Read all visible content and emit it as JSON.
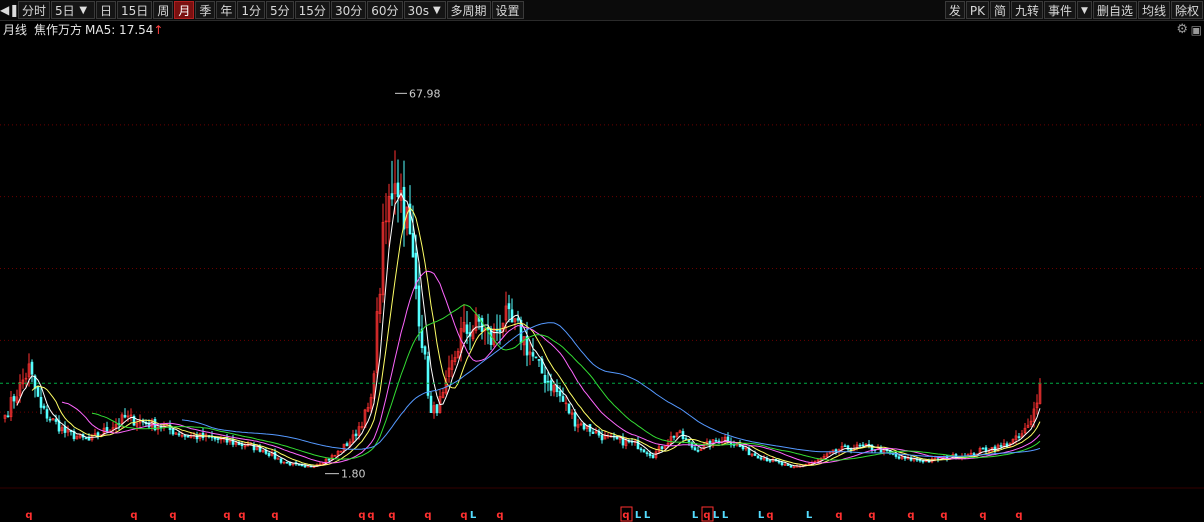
{
  "toolbar": {
    "left": [
      {
        "label": "分时",
        "active": false
      },
      {
        "label": "5日",
        "active": false,
        "dropdown": true
      },
      {
        "label": "日",
        "active": false
      },
      {
        "label": "15日",
        "active": false
      },
      {
        "label": "周",
        "active": false
      },
      {
        "label": "月",
        "active": true
      },
      {
        "label": "季",
        "active": false
      },
      {
        "label": "年",
        "active": false
      },
      {
        "label": "1分",
        "active": false
      },
      {
        "label": "5分",
        "active": false
      },
      {
        "label": "15分",
        "active": false
      },
      {
        "label": "30分",
        "active": false
      },
      {
        "label": "60分",
        "active": false
      },
      {
        "label": "30s",
        "active": false,
        "dropdown": true
      },
      {
        "label": "多周期",
        "active": false
      },
      {
        "label": "设置",
        "active": false
      }
    ],
    "right": [
      {
        "label": "发"
      },
      {
        "label": "PK"
      },
      {
        "label": "简"
      },
      {
        "label": "九转"
      },
      {
        "label": "事件",
        "dropdown": true
      },
      {
        "label": "删自选"
      },
      {
        "label": "均线"
      },
      {
        "label": "除权"
      }
    ],
    "icons": {
      "toggle": "sidebar-toggle-icon",
      "dropdown": "triangle-down-icon",
      "gear": "gear-icon",
      "expand": "expand-icon"
    }
  },
  "info": {
    "period": "月线",
    "name": "焦作万方",
    "ma_label": "MA5: 17.54",
    "ma_arrow": "↑"
  },
  "colors": {
    "background": "#000000",
    "up": "#ff3232",
    "down": "#54ffff",
    "ma5": "#ffffff",
    "ma10": "#ffff66",
    "ma20": "#ff66ff",
    "ma30": "#33dd33",
    "ma60": "#5599ff",
    "grid": "#6a0000",
    "current_line": "#00aa44",
    "q": "#ff3030",
    "L": "#55ddff"
  },
  "chart_data": {
    "type": "candlestick",
    "period": "monthly",
    "symbol_name": "焦作万方",
    "ylim": [
      0,
      75
    ],
    "price_high_label": "67.98",
    "price_low_label": "1.80",
    "current_price": 17.54,
    "ma": [
      {
        "name": "MA5",
        "color": "#ffffff"
      },
      {
        "name": "MA10",
        "color": "#ffff66"
      },
      {
        "name": "MA20",
        "color": "#ff66ff"
      },
      {
        "name": "MA30",
        "color": "#33dd33"
      },
      {
        "name": "MA60",
        "color": "#5599ff"
      }
    ],
    "close_anchors": [
      [
        0,
        12.0
      ],
      [
        8,
        20.0
      ],
      [
        12,
        13.0
      ],
      [
        20,
        9.0
      ],
      [
        28,
        7.5
      ],
      [
        40,
        11.5
      ],
      [
        52,
        10.0
      ],
      [
        60,
        8.5
      ],
      [
        68,
        8.0
      ],
      [
        78,
        7.0
      ],
      [
        86,
        6.0
      ],
      [
        92,
        4.0
      ],
      [
        100,
        2.8
      ],
      [
        104,
        3.5
      ],
      [
        110,
        5.0
      ],
      [
        116,
        8.0
      ],
      [
        122,
        14.0
      ],
      [
        126,
        42.0
      ],
      [
        130,
        55.0
      ],
      [
        134,
        46.0
      ],
      [
        138,
        30.0
      ],
      [
        142,
        12.0
      ],
      [
        146,
        15.0
      ],
      [
        152,
        26.0
      ],
      [
        158,
        28.0
      ],
      [
        162,
        25.0
      ],
      [
        166,
        29.0
      ],
      [
        172,
        26.0
      ],
      [
        178,
        20.0
      ],
      [
        184,
        16.0
      ],
      [
        190,
        11.0
      ],
      [
        200,
        8.0
      ],
      [
        210,
        7.0
      ],
      [
        216,
        5.0
      ],
      [
        224,
        9.0
      ],
      [
        230,
        6.0
      ],
      [
        240,
        8.0
      ],
      [
        248,
        5.5
      ],
      [
        256,
        4.0
      ],
      [
        262,
        2.8
      ],
      [
        270,
        3.8
      ],
      [
        278,
        6.0
      ],
      [
        286,
        6.5
      ],
      [
        292,
        6.0
      ],
      [
        298,
        4.5
      ],
      [
        308,
        4.0
      ],
      [
        316,
        4.8
      ],
      [
        322,
        5.0
      ],
      [
        326,
        6.0
      ],
      [
        332,
        6.5
      ],
      [
        338,
        8.0
      ],
      [
        342,
        10.5
      ],
      [
        345,
        17.54
      ]
    ],
    "signal_marks": [
      {
        "label": "q",
        "index": 8,
        "boxed": false
      },
      {
        "label": "q",
        "index": 43,
        "boxed": false
      },
      {
        "label": "q",
        "index": 56,
        "boxed": false
      },
      {
        "label": "q",
        "index": 74,
        "boxed": false
      },
      {
        "label": "q",
        "index": 79,
        "boxed": false
      },
      {
        "label": "q",
        "index": 90,
        "boxed": false
      },
      {
        "label": "q",
        "index": 119,
        "boxed": false
      },
      {
        "label": "q",
        "index": 122,
        "boxed": false
      },
      {
        "label": "q",
        "index": 129,
        "boxed": false
      },
      {
        "label": "q",
        "index": 141,
        "boxed": false
      },
      {
        "label": "q",
        "index": 153,
        "boxed": false
      },
      {
        "label": "L",
        "index": 156,
        "boxed": false
      },
      {
        "label": "q",
        "index": 165,
        "boxed": false
      },
      {
        "label": "q",
        "index": 207,
        "boxed": true
      },
      {
        "label": "L",
        "index": 211,
        "boxed": false
      },
      {
        "label": "L",
        "index": 214,
        "boxed": false
      },
      {
        "label": "L",
        "index": 230,
        "boxed": false
      },
      {
        "label": "q",
        "index": 234,
        "boxed": true
      },
      {
        "label": "L",
        "index": 237,
        "boxed": false
      },
      {
        "label": "L",
        "index": 240,
        "boxed": false
      },
      {
        "label": "L",
        "index": 252,
        "boxed": false
      },
      {
        "label": "q",
        "index": 255,
        "boxed": false
      },
      {
        "label": "L",
        "index": 268,
        "boxed": false
      },
      {
        "label": "q",
        "index": 278,
        "boxed": false
      },
      {
        "label": "q",
        "index": 289,
        "boxed": false
      },
      {
        "label": "q",
        "index": 302,
        "boxed": false
      },
      {
        "label": "q",
        "index": 313,
        "boxed": false
      },
      {
        "label": "q",
        "index": 326,
        "boxed": false
      },
      {
        "label": "q",
        "index": 338,
        "boxed": false
      }
    ]
  }
}
